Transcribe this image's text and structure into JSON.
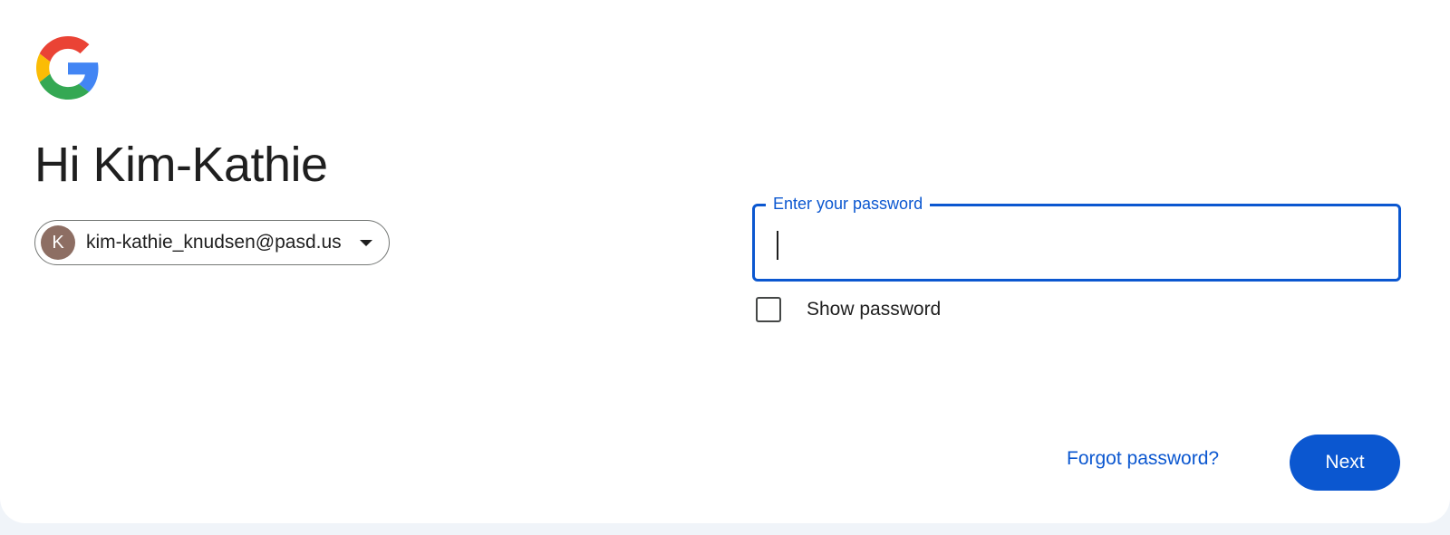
{
  "header": {
    "logo_icon": "google-g-logo",
    "greeting": "Hi Kim-Kathie"
  },
  "account": {
    "avatar_initial": "K",
    "avatar_color": "#8d6e63",
    "email": "kim-kathie_knudsen@pasd.us",
    "dropdown_icon": "chevron-down-icon"
  },
  "password_field": {
    "label": "Enter your password",
    "value": "",
    "type": "password",
    "focused": true
  },
  "show_password": {
    "label": "Show password",
    "checked": false
  },
  "actions": {
    "forgot_label": "Forgot password?",
    "next_label": "Next"
  },
  "colors": {
    "accent": "#0b57d0",
    "background": "#f0f4f9",
    "text": "#1f1f1f"
  }
}
